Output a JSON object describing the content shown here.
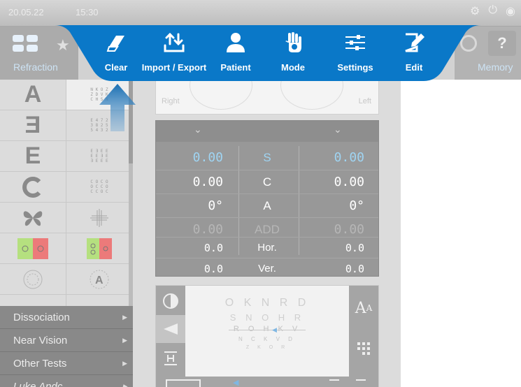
{
  "top_bar": {
    "date": "20.05.22",
    "time": "15:30"
  },
  "tabs": {
    "refraction_label": "Refraction",
    "memory_label": "Memory",
    "help_label": "?"
  },
  "toolbar": {
    "items": [
      {
        "label": "Clear",
        "icon": "eraser-icon"
      },
      {
        "label": "Import / Export",
        "icon": "import-export-icon"
      },
      {
        "label": "Patient",
        "icon": "patient-icon"
      },
      {
        "label": "Mode",
        "icon": "hand-gear-icon"
      },
      {
        "label": "Settings",
        "icon": "sliders-icon"
      },
      {
        "label": "Edit",
        "icon": "edit-icon"
      }
    ],
    "color": "#0a78c8"
  },
  "left_charts": {
    "big_letters": [
      "A",
      "Ǝ",
      "E",
      "○",
      "✖"
    ],
    "mini_rows": [
      [
        "N K O Z",
        "Z D V K",
        "C H S N"
      ],
      [
        "E 4 7 2",
        "3 8 2 5",
        "5 4 3 2"
      ],
      [
        "E Ǝ E E",
        "E E Ǝ E",
        "Ǝ E E E"
      ],
      [
        "C O C O",
        "O C C O",
        "C C O C"
      ]
    ]
  },
  "menu": {
    "items": [
      "Dissociation",
      "Near Vision",
      "Other Tests",
      "Luke Andc"
    ]
  },
  "eye_labels": {
    "right": "Right",
    "left": "Left"
  },
  "prescription": {
    "rows": [
      {
        "left": "0.00",
        "label": "S",
        "right": "0.00",
        "highlight": true
      },
      {
        "left": "0.00",
        "label": "C",
        "right": "0.00",
        "highlight": false
      },
      {
        "left": "0°",
        "label": "A",
        "right": "0°",
        "highlight": false
      },
      {
        "left": "0.00",
        "label": "ADD",
        "right": "0.00",
        "dim": true
      },
      {
        "left": "0.0",
        "label": "Hor.",
        "right": "0.0",
        "small": true
      },
      {
        "left": "0.0",
        "label": "Ver.",
        "right": "0.0",
        "small": true
      }
    ],
    "highlight_color": "#9fd4f2"
  },
  "acuity": {
    "row1": "O K N R D",
    "row2": "S N O H R",
    "row3": "R O H K V",
    "row4": "N C K V D",
    "row5": "Z K O R"
  },
  "buttons": {
    "font_size_label": "A",
    "font_size_small": "A"
  }
}
